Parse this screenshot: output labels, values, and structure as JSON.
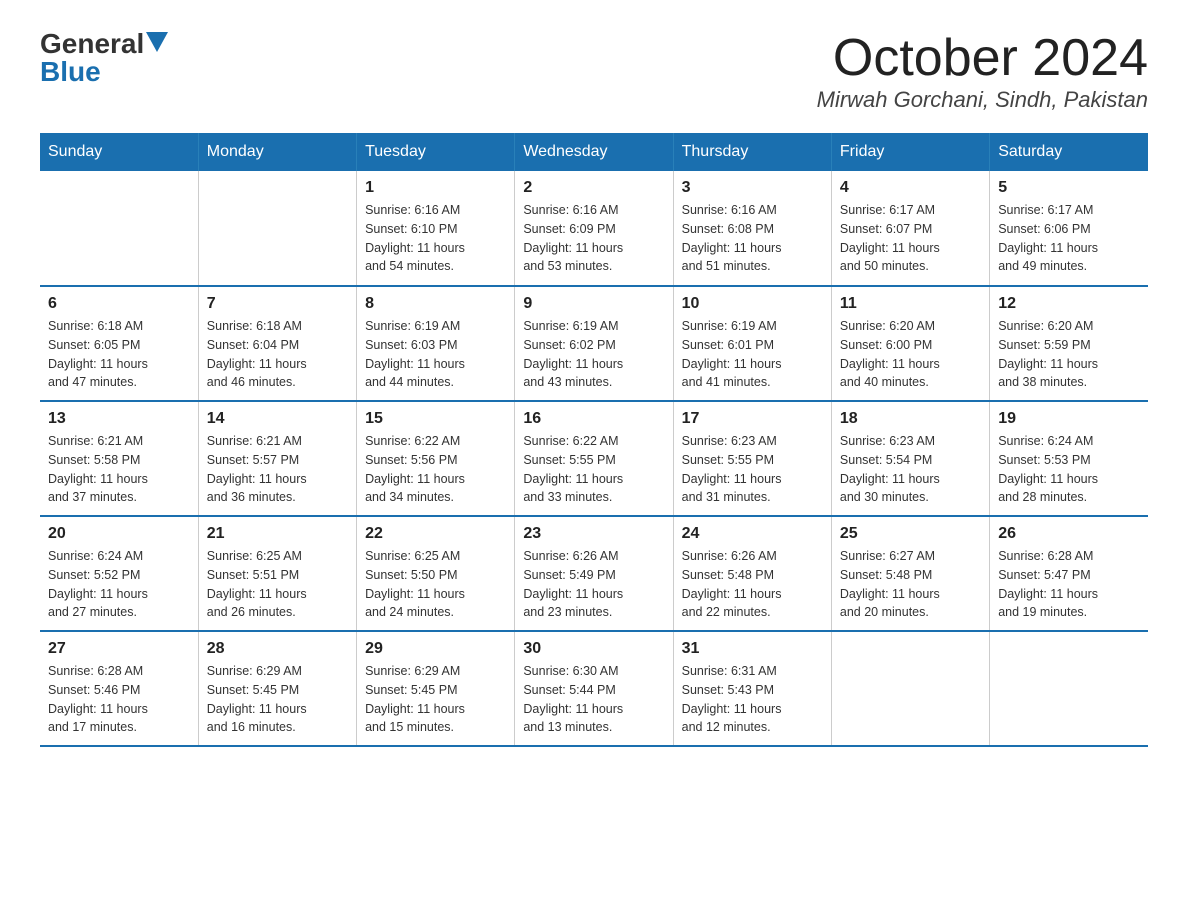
{
  "header": {
    "logo_general": "General",
    "logo_blue": "Blue",
    "month_title": "October 2024",
    "location": "Mirwah Gorchani, Sindh, Pakistan"
  },
  "weekdays": [
    "Sunday",
    "Monday",
    "Tuesday",
    "Wednesday",
    "Thursday",
    "Friday",
    "Saturday"
  ],
  "weeks": [
    [
      {
        "day": "",
        "info": ""
      },
      {
        "day": "",
        "info": ""
      },
      {
        "day": "1",
        "info": "Sunrise: 6:16 AM\nSunset: 6:10 PM\nDaylight: 11 hours\nand 54 minutes."
      },
      {
        "day": "2",
        "info": "Sunrise: 6:16 AM\nSunset: 6:09 PM\nDaylight: 11 hours\nand 53 minutes."
      },
      {
        "day": "3",
        "info": "Sunrise: 6:16 AM\nSunset: 6:08 PM\nDaylight: 11 hours\nand 51 minutes."
      },
      {
        "day": "4",
        "info": "Sunrise: 6:17 AM\nSunset: 6:07 PM\nDaylight: 11 hours\nand 50 minutes."
      },
      {
        "day": "5",
        "info": "Sunrise: 6:17 AM\nSunset: 6:06 PM\nDaylight: 11 hours\nand 49 minutes."
      }
    ],
    [
      {
        "day": "6",
        "info": "Sunrise: 6:18 AM\nSunset: 6:05 PM\nDaylight: 11 hours\nand 47 minutes."
      },
      {
        "day": "7",
        "info": "Sunrise: 6:18 AM\nSunset: 6:04 PM\nDaylight: 11 hours\nand 46 minutes."
      },
      {
        "day": "8",
        "info": "Sunrise: 6:19 AM\nSunset: 6:03 PM\nDaylight: 11 hours\nand 44 minutes."
      },
      {
        "day": "9",
        "info": "Sunrise: 6:19 AM\nSunset: 6:02 PM\nDaylight: 11 hours\nand 43 minutes."
      },
      {
        "day": "10",
        "info": "Sunrise: 6:19 AM\nSunset: 6:01 PM\nDaylight: 11 hours\nand 41 minutes."
      },
      {
        "day": "11",
        "info": "Sunrise: 6:20 AM\nSunset: 6:00 PM\nDaylight: 11 hours\nand 40 minutes."
      },
      {
        "day": "12",
        "info": "Sunrise: 6:20 AM\nSunset: 5:59 PM\nDaylight: 11 hours\nand 38 minutes."
      }
    ],
    [
      {
        "day": "13",
        "info": "Sunrise: 6:21 AM\nSunset: 5:58 PM\nDaylight: 11 hours\nand 37 minutes."
      },
      {
        "day": "14",
        "info": "Sunrise: 6:21 AM\nSunset: 5:57 PM\nDaylight: 11 hours\nand 36 minutes."
      },
      {
        "day": "15",
        "info": "Sunrise: 6:22 AM\nSunset: 5:56 PM\nDaylight: 11 hours\nand 34 minutes."
      },
      {
        "day": "16",
        "info": "Sunrise: 6:22 AM\nSunset: 5:55 PM\nDaylight: 11 hours\nand 33 minutes."
      },
      {
        "day": "17",
        "info": "Sunrise: 6:23 AM\nSunset: 5:55 PM\nDaylight: 11 hours\nand 31 minutes."
      },
      {
        "day": "18",
        "info": "Sunrise: 6:23 AM\nSunset: 5:54 PM\nDaylight: 11 hours\nand 30 minutes."
      },
      {
        "day": "19",
        "info": "Sunrise: 6:24 AM\nSunset: 5:53 PM\nDaylight: 11 hours\nand 28 minutes."
      }
    ],
    [
      {
        "day": "20",
        "info": "Sunrise: 6:24 AM\nSunset: 5:52 PM\nDaylight: 11 hours\nand 27 minutes."
      },
      {
        "day": "21",
        "info": "Sunrise: 6:25 AM\nSunset: 5:51 PM\nDaylight: 11 hours\nand 26 minutes."
      },
      {
        "day": "22",
        "info": "Sunrise: 6:25 AM\nSunset: 5:50 PM\nDaylight: 11 hours\nand 24 minutes."
      },
      {
        "day": "23",
        "info": "Sunrise: 6:26 AM\nSunset: 5:49 PM\nDaylight: 11 hours\nand 23 minutes."
      },
      {
        "day": "24",
        "info": "Sunrise: 6:26 AM\nSunset: 5:48 PM\nDaylight: 11 hours\nand 22 minutes."
      },
      {
        "day": "25",
        "info": "Sunrise: 6:27 AM\nSunset: 5:48 PM\nDaylight: 11 hours\nand 20 minutes."
      },
      {
        "day": "26",
        "info": "Sunrise: 6:28 AM\nSunset: 5:47 PM\nDaylight: 11 hours\nand 19 minutes."
      }
    ],
    [
      {
        "day": "27",
        "info": "Sunrise: 6:28 AM\nSunset: 5:46 PM\nDaylight: 11 hours\nand 17 minutes."
      },
      {
        "day": "28",
        "info": "Sunrise: 6:29 AM\nSunset: 5:45 PM\nDaylight: 11 hours\nand 16 minutes."
      },
      {
        "day": "29",
        "info": "Sunrise: 6:29 AM\nSunset: 5:45 PM\nDaylight: 11 hours\nand 15 minutes."
      },
      {
        "day": "30",
        "info": "Sunrise: 6:30 AM\nSunset: 5:44 PM\nDaylight: 11 hours\nand 13 minutes."
      },
      {
        "day": "31",
        "info": "Sunrise: 6:31 AM\nSunset: 5:43 PM\nDaylight: 11 hours\nand 12 minutes."
      },
      {
        "day": "",
        "info": ""
      },
      {
        "day": "",
        "info": ""
      }
    ]
  ]
}
